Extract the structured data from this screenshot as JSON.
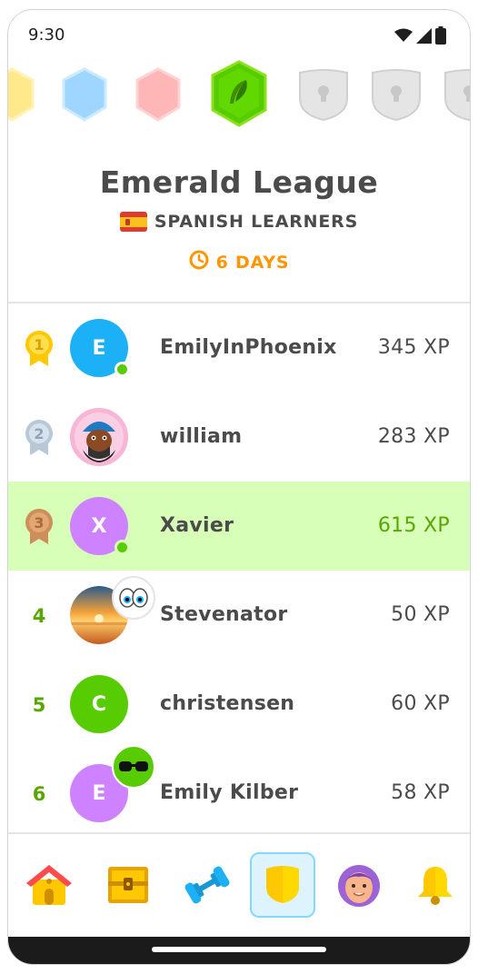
{
  "status_bar": {
    "time": "9:30"
  },
  "league": {
    "title": "Emerald League",
    "subtitle": "SPANISH LEARNERS",
    "timer": "6 DAYS",
    "badges": [
      {
        "name": "gold",
        "color": "#ffde59",
        "state": "past"
      },
      {
        "name": "sapphire",
        "color": "#a5d8ff",
        "state": "past"
      },
      {
        "name": "ruby",
        "color": "#ffb3b3",
        "state": "past"
      },
      {
        "name": "emerald",
        "color": "#58cc02",
        "state": "current"
      },
      {
        "name": "locked-1",
        "color": "#e5e5e5",
        "state": "locked"
      },
      {
        "name": "locked-2",
        "color": "#e5e5e5",
        "state": "locked"
      },
      {
        "name": "locked-3",
        "color": "#e5e5e5",
        "state": "locked"
      }
    ]
  },
  "leaderboard": [
    {
      "rank": "1",
      "name": "EmilyInPhoenix",
      "xp": "345 XP",
      "initial": "E",
      "avatar_color": "#1cb0f6"
    },
    {
      "rank": "2",
      "name": "william",
      "xp": "283 XP",
      "initial": "",
      "avatar_color": "#f8b6d6"
    },
    {
      "rank": "3",
      "name": "Xavier",
      "xp": "615 XP",
      "initial": "X",
      "avatar_color": "#ce82ff"
    },
    {
      "rank": "4",
      "name": "Stevenator",
      "xp": "50 XP",
      "initial": "",
      "avatar_color": "#f28c28"
    },
    {
      "rank": "5",
      "name": "christensen",
      "xp": "60 XP",
      "initial": "C",
      "avatar_color": "#58cc02"
    },
    {
      "rank": "6",
      "name": "Emily Kilber",
      "xp": "58 XP",
      "initial": "E",
      "avatar_color": "#ce82ff"
    }
  ],
  "nav": [
    {
      "name": "home",
      "icon": "house-icon"
    },
    {
      "name": "stories",
      "icon": "treasure-chest-icon"
    },
    {
      "name": "practice",
      "icon": "dumbbell-icon"
    },
    {
      "name": "leagues",
      "icon": "shield-icon",
      "active": true
    },
    {
      "name": "profile",
      "icon": "avatar-icon"
    },
    {
      "name": "notifications",
      "icon": "bell-icon"
    }
  ],
  "colors": {
    "accent_green": "#58cc02",
    "highlight_row": "#d7ffb8",
    "timer_orange": "#ff9600",
    "text_dark": "#4b4b4b"
  }
}
